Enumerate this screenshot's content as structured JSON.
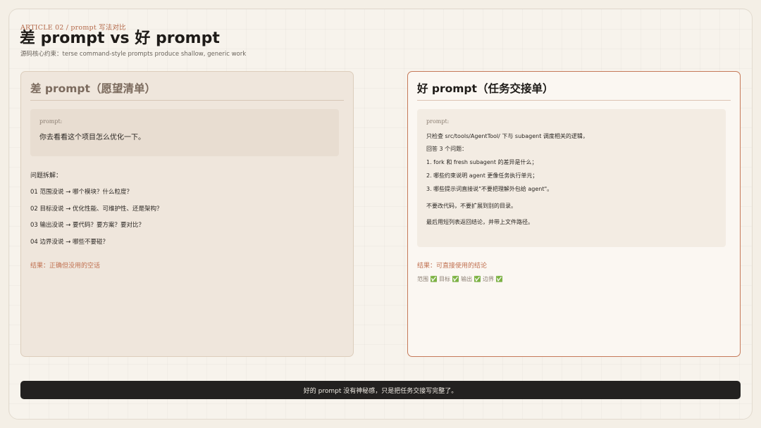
{
  "header": {
    "kicker": "ARTICLE 02 / prompt 写法对比",
    "title": "差 prompt vs 好 prompt",
    "subtitle": "源码核心约束：terse command-style prompts produce shallow, generic work"
  },
  "bad_card": {
    "title": "差 prompt（愿望清单）",
    "prompt_label": "prompt:",
    "prompt_text": "你去看看这个项目怎么优化一下。",
    "issues_heading": "问题拆解：",
    "issues": [
      "01 范围没说 → 哪个模块？什么粒度？",
      "02 目标没说 → 优化性能、可维护性、还是架构？",
      "03 输出没说 → 要代码？要方案？要对比？",
      "04 边界没说 → 哪些不要碰？"
    ],
    "result": "结果：正确但没用的空话"
  },
  "good_card": {
    "title": "好 prompt（任务交接单）",
    "prompt_label": "prompt:",
    "prompt_lines": [
      "只检查 src/tools/AgentTool/ 下与 subagent 调度相关的逻辑，",
      "回答 3 个问题：",
      "1. fork 和 fresh subagent 的差异是什么；",
      "2. 哪些约束说明 agent 更像任务执行单元；",
      "3. 哪些提示词直接说\"不要把理解外包给 agent\"。",
      "不要改代码，不要扩展到别的目录。",
      "最后用短列表返回结论，并带上文件路径。"
    ],
    "result": "结果：可直接使用的结论",
    "checks": "范围 ✅ 目标 ✅ 输出 ✅ 边界 ✅"
  },
  "footer": {
    "text": "好的 prompt 没有神秘感，只是把任务交接写完整了。"
  },
  "colors": {
    "accent": "#c07050",
    "bad_card_bg": "#efe6dc",
    "good_card_border": "#c57a59",
    "footer_bg": "#232120"
  }
}
